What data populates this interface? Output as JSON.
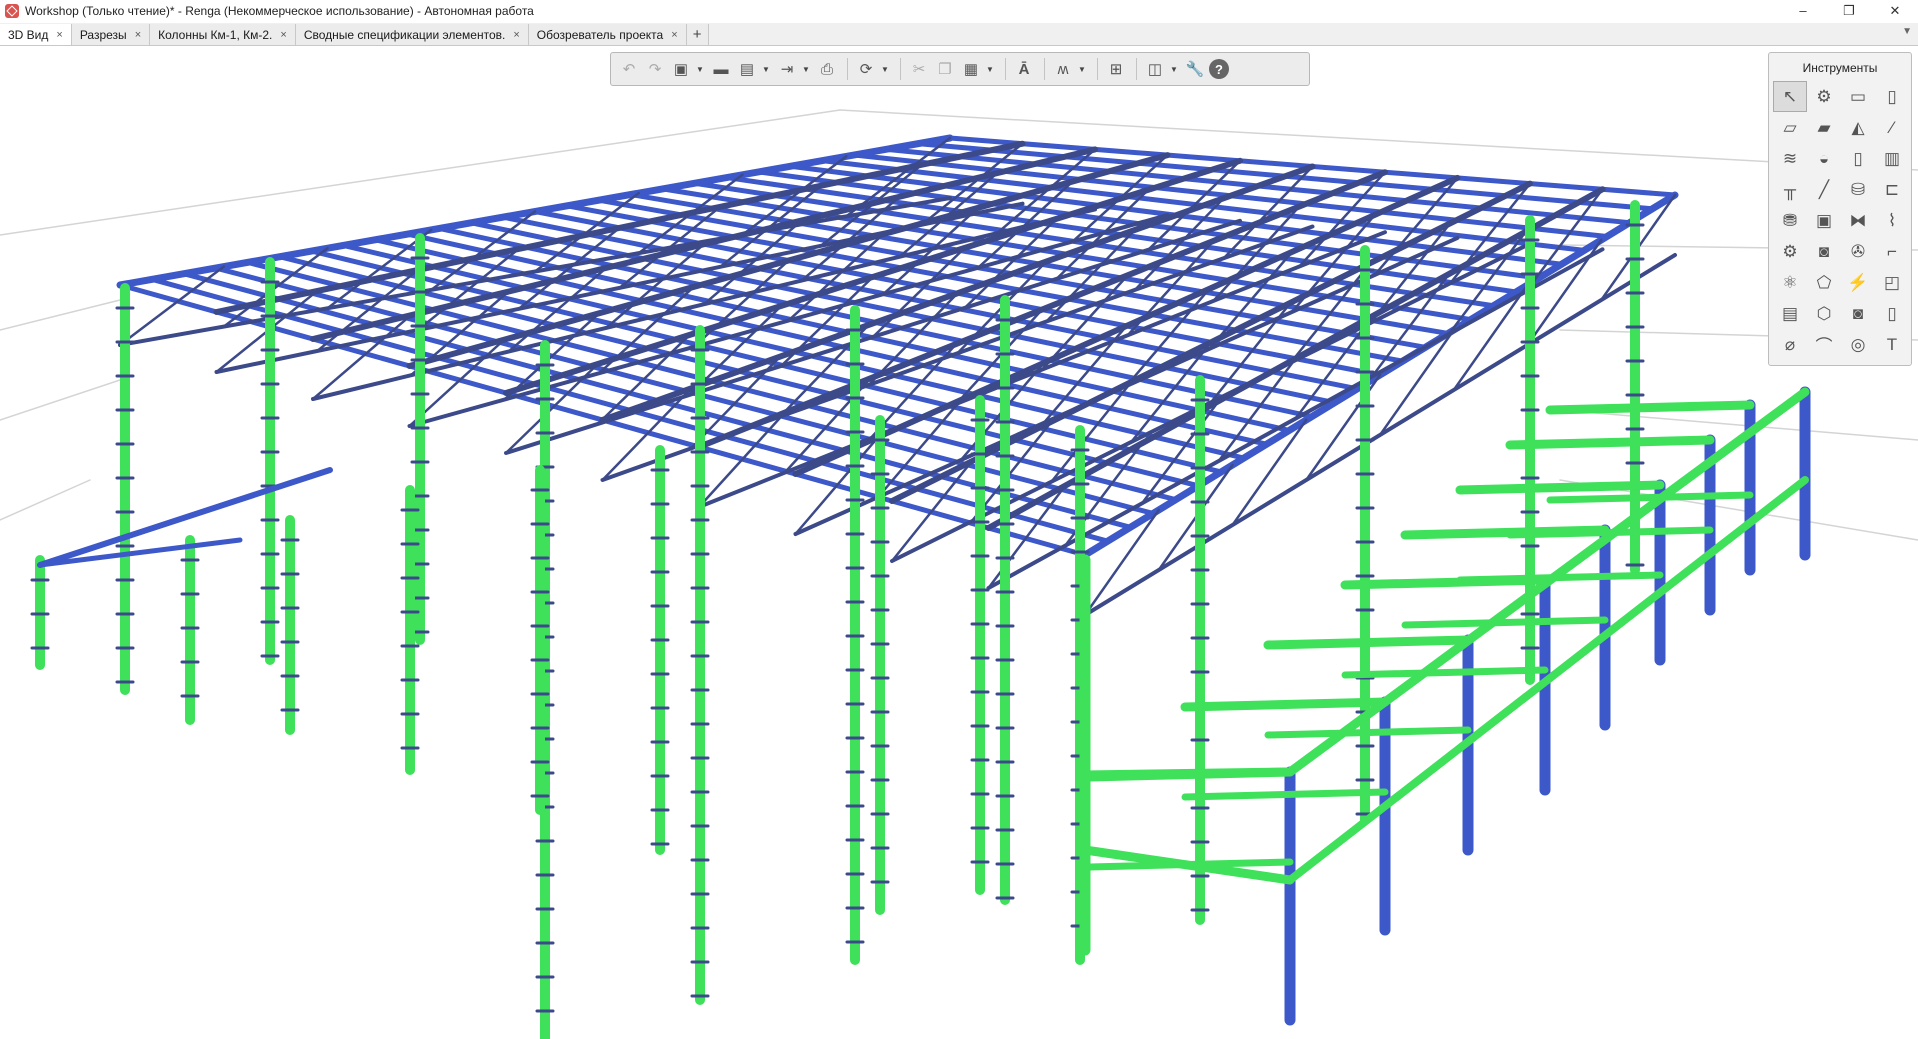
{
  "window": {
    "title": "Workshop (Только чтение)* - Renga (Некоммерческое использование) - Автономная работа",
    "minimize_glyph": "–",
    "maximize_glyph": "❐",
    "close_glyph": "✕"
  },
  "tabs": [
    {
      "label": "3D Вид",
      "active": true
    },
    {
      "label": "Разрезы"
    },
    {
      "label": "Колонны Км-1, Км-2."
    },
    {
      "label": "Сводные спецификации элементов."
    },
    {
      "label": "Обозреватель проекта"
    }
  ],
  "tab_close_glyph": "×",
  "tab_add_glyph": "+",
  "tab_menu_glyph": "▼",
  "toolbar_icons": [
    "undo-icon",
    "redo-icon",
    "view-cube-icon",
    "open-folder-icon",
    "save-icon",
    "export-icon",
    "print-icon",
    "orbit-icon",
    "cut-icon",
    "copy-icon",
    "paste-icon",
    "text-style-icon",
    "level-icon",
    "layers-icon",
    "visibility-icon",
    "settings-wrench-icon",
    "help-icon"
  ],
  "toolbar_help_glyph": "?",
  "instruments": {
    "title": "Инструменты",
    "text_tool_glyph": "T",
    "icons": [
      "select-icon",
      "wall-icon",
      "column-icon",
      "window-icon",
      "floor-icon",
      "slab-icon",
      "roof-icon",
      "beam-icon",
      "rebar-icon",
      "opening-icon",
      "door-icon",
      "stair-icon",
      "railing-icon",
      "line-icon",
      "equipment-icon",
      "duct-icon",
      "pipe-icon",
      "box-icon",
      "valve-icon",
      "fitting-icon",
      "mechanical-icon",
      "electrical-icon",
      "fan-icon",
      "elbow-icon",
      "plumbing-icon",
      "lamp-icon",
      "switch-icon",
      "element-icon",
      "room-icon",
      "assembly-icon",
      "light-fixture-icon",
      "door-detail-icon",
      "dimension-icon",
      "arc-icon",
      "hatch-icon",
      "text-icon"
    ]
  },
  "colors": {
    "column_green": "#3fe05a",
    "steel_blue": "#3d58c8",
    "dark_steel": "#3c4a8a",
    "toolbar_bg": "#ececec"
  }
}
